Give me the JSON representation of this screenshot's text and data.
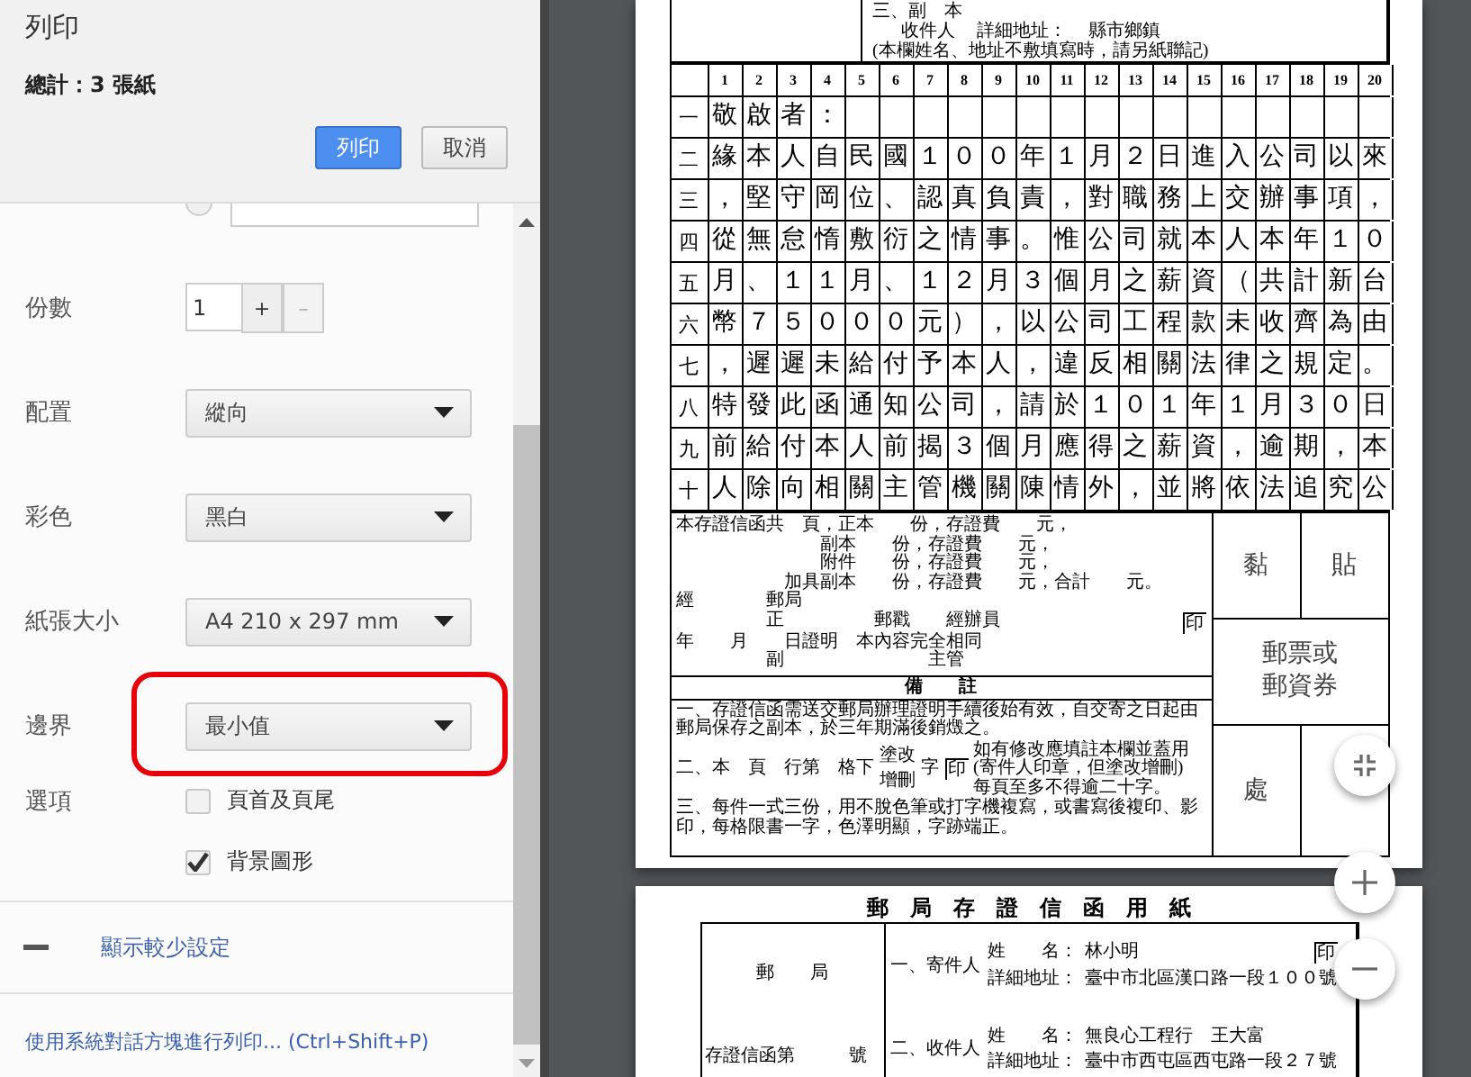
{
  "header": {
    "title": "列印",
    "summary": "總計：3 張紙",
    "buttons": [
      {
        "label": "列印",
        "kind": "primary"
      },
      {
        "label": "取消",
        "kind": "secondary"
      }
    ]
  },
  "page_range": {
    "selected": false
  },
  "settings": [
    {
      "label": "份數",
      "kind": "stepper",
      "value": "1",
      "increment": "+",
      "decrement": "–"
    },
    {
      "label": "配置",
      "kind": "select",
      "value": "縱向",
      "highlighted": false
    },
    {
      "label": "彩色",
      "kind": "select",
      "value": "黑白",
      "highlighted": false
    },
    {
      "label": "紙張大小",
      "kind": "select",
      "value": "A4 210 x 297 mm",
      "highlighted": false
    },
    {
      "label": "邊界",
      "kind": "select",
      "value": "最小值",
      "highlighted": true
    },
    {
      "label": "選項",
      "kind": "checkboxes",
      "options": [
        {
          "label": "頁首及頁尾",
          "checked": false
        },
        {
          "label": "背景圖形",
          "checked": true
        }
      ]
    }
  ],
  "fewer_settings_link": "顯示較少設定",
  "system_dialog_link": "使用系統對話方塊進行列印... (Ctrl+Shift+P)",
  "preview": {
    "page1": {
      "cc": {
        "heading": "三、副　本",
        "recipient": "收件人",
        "address_label": "詳細地址：",
        "address": "縣市鄉鎮",
        "note": "(本欄姓名、地址不敷填寫時，請另紙聯記)"
      },
      "column_numbers": [
        "1",
        "2",
        "3",
        "4",
        "5",
        "6",
        "7",
        "8",
        "9",
        "10",
        "11",
        "12",
        "13",
        "14",
        "15",
        "16",
        "17",
        "18",
        "19",
        "20"
      ],
      "rows": [
        {
          "label": "一",
          "text": "敬啟者："
        },
        {
          "label": "二",
          "text": "緣本人自民國１００年１月２日進入公司以來"
        },
        {
          "label": "三",
          "text": "，堅守岡位、認真負責，對職務上交辦事項，"
        },
        {
          "label": "四",
          "text": "從無怠惰敷衍之情事。惟公司就本人本年１０"
        },
        {
          "label": "五",
          "text": "月、１１月、１２月３個月之薪資（共計新台"
        },
        {
          "label": "六",
          "text": "幣７５０００元），以公司工程款未收齊為由"
        },
        {
          "label": "七",
          "text": "，遲遲未給付予本人，違反相關法律之規定。"
        },
        {
          "label": "八",
          "text": "特發此函通知公司，請於１０１年１月３０日"
        },
        {
          "label": "九",
          "text": "前給付本人前揭３個月應得之薪資，逾期，本"
        },
        {
          "label": "十",
          "text": "人除向相關主管機關陳情外，並將依法追究公"
        }
      ],
      "fee_lines": [
        "本存證信函共　頁，正本　　份，存證費　　元，",
        "　　　　　　　　副本　　份，存證費　　元，",
        "　　　　　　　　附件　　份，存證費　　元，",
        "　　　　　　加具副本　　份，存證費　　元，合計　　元。",
        "經　　　　郵局",
        "　　　　　正　　　　　郵戳　　經辦員",
        "年　　月　　日證明　本內容完全相同",
        "　　　　　副　　　　　　　　主管"
      ],
      "fee_seal": "印",
      "remarks_heading": "備　　註",
      "note1": "一、存證信函需送交郵局辦理證明手續後始有效，自交寄之日起由郵局保存之副本，於三年期滿後銷燬之。",
      "note2": {
        "prefix": "二、本　頁　行第　格下",
        "edit_top": "塗改",
        "edit_bottom": "增刪",
        "unit": "字",
        "seal": "印",
        "instruction": "如有修改應填註本欄並蓋用(寄件人印章，但塗改增刪)每頁至多不得逾二十字。"
      },
      "note3": "三、每件一式三份，用不脫色筆或打字機複寫，或書寫後複印、影印，每格限書一字，色澤明顯，字跡端正。",
      "stamp": {
        "top_left": "黏",
        "top_right": "貼",
        "middle": "郵票或郵資券",
        "bottom_left": "處"
      }
    },
    "page2": {
      "title": "郵　局　存　證　信　函　用　紙",
      "office": "郵　　局",
      "serial": "存證信函第　　　號",
      "parties": [
        {
          "role": "一、寄件人",
          "name_label": "姓　　名：",
          "name": "林小明",
          "address_label": "詳細地址：",
          "address": "臺中市北區漢口路一段１００號",
          "seal": "印"
        },
        {
          "role": "二、收件人",
          "name_label": "姓　　名：",
          "name": "無良心工程行　王大富",
          "address_label": "詳細地址：",
          "address": "臺中市西屯區西屯路一段２７號"
        }
      ]
    }
  }
}
